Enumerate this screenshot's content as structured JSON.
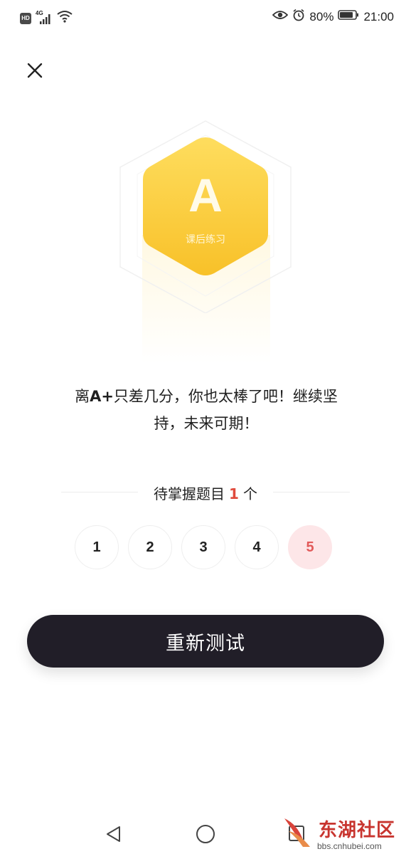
{
  "status_bar": {
    "hd": "HD",
    "network": "4G",
    "battery": "80%",
    "time": "21:00"
  },
  "badge": {
    "letter": "A",
    "subtitle": "课后练习",
    "color_top": "#fedb5a",
    "color_bottom": "#f9c52c"
  },
  "message": {
    "before": "离",
    "grade": "A+",
    "line1_rest": "只差几分，你也太棒了吧！继续坚",
    "line2": "持，未来可期！"
  },
  "pending": {
    "before": "待掌握题目",
    "count": "1",
    "after": "个"
  },
  "questions": [
    {
      "label": "1",
      "state": "correct"
    },
    {
      "label": "2",
      "state": "correct"
    },
    {
      "label": "3",
      "state": "correct"
    },
    {
      "label": "4",
      "state": "correct"
    },
    {
      "label": "5",
      "state": "wrong"
    }
  ],
  "retest_button": {
    "label": "重新测试"
  },
  "watermark": {
    "title": "东湖社区",
    "url": "bbs.cnhubei.com"
  },
  "colors": {
    "accent_red": "#e04a3c",
    "button_dark": "#211e28",
    "wrong_bg": "#fde6e8"
  }
}
